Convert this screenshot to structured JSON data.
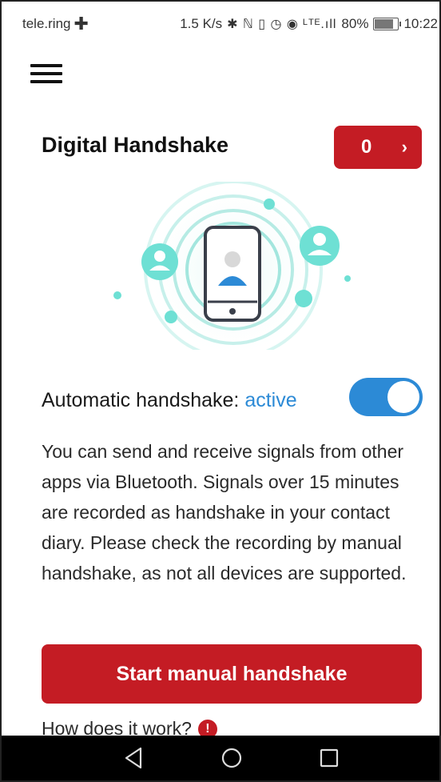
{
  "status_bar": {
    "carrier": "tele.ring",
    "carrier_mark": "✚",
    "speed": "1.5 K/s",
    "icons": "✱ ℕ ▯ ◷ ◉ ᴸᵀᴱ.ıll",
    "battery_percent": "80%",
    "battery_level": 0.8,
    "time": "10:22"
  },
  "header": {
    "menu_icon": "hamburger-menu-icon"
  },
  "page": {
    "title": "Digital Handshake",
    "counter_value": "0",
    "counter_chevron": "›"
  },
  "toggle": {
    "label": "Automatic handshake: ",
    "state": "active",
    "on": true
  },
  "description": "You can send and receive signals from other apps via Bluetooth. Signals over 15 minutes are recorded as handshake in your contact diary. Please check the recording by manual handshake, as not all devices are supported.",
  "primary_button": {
    "label": "Start manual handshake"
  },
  "help_link": {
    "label": "How does it work?",
    "icon_glyph": "!"
  },
  "colors": {
    "accent_red": "#c41c24",
    "toggle_blue": "#2c8ad6",
    "teal": "#6ee0d4",
    "illustration_blue": "#2c8ad6"
  },
  "nav": {
    "back_icon": "back-triangle-icon",
    "home_icon": "home-circle-icon",
    "recents_icon": "recents-square-icon"
  }
}
